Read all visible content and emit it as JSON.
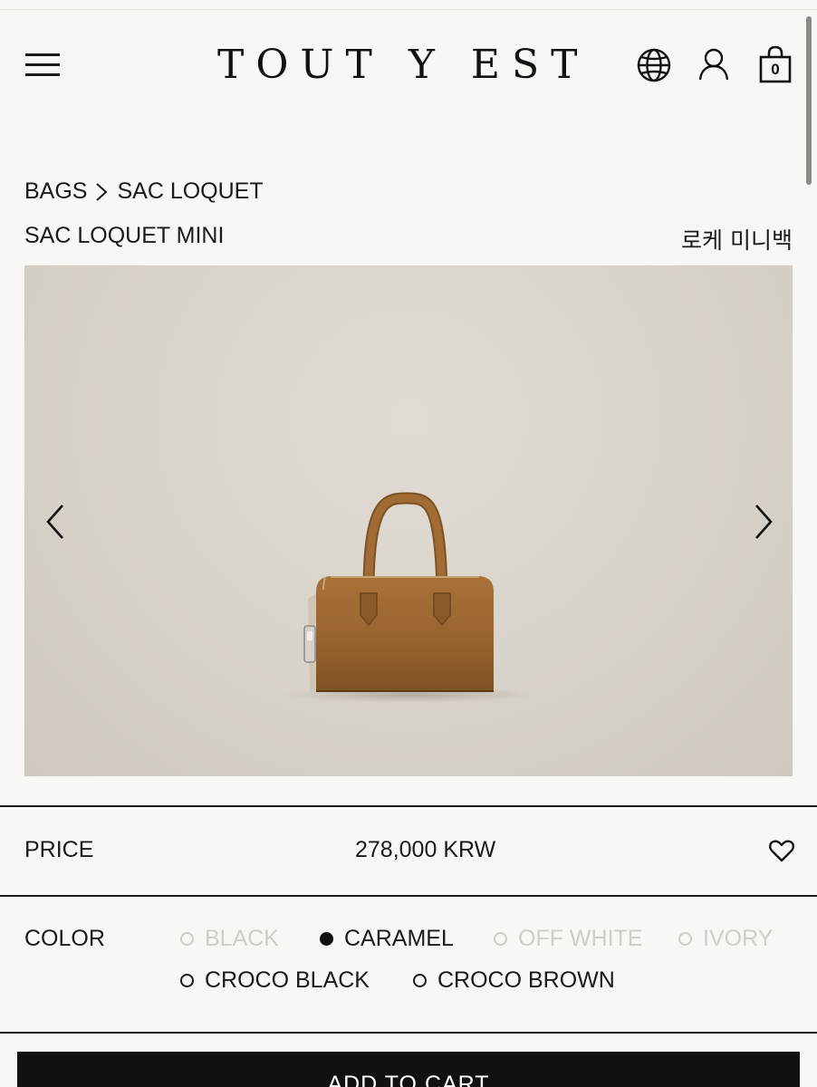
{
  "header": {
    "logo": "TOUT Y EST",
    "cart_count": "0"
  },
  "breadcrumb": {
    "category": "BAGS",
    "collection": "SAC LOQUET"
  },
  "product": {
    "title": "SAC LOQUET MINI",
    "title_ko": "로케 미니백"
  },
  "price": {
    "label": "PRICE",
    "value": "278,000 KRW"
  },
  "color": {
    "label": "COLOR",
    "options": [
      {
        "label": "BLACK",
        "state": "disabled"
      },
      {
        "label": "CARAMEL",
        "state": "selected"
      },
      {
        "label": "OFF WHITE",
        "state": "disabled"
      },
      {
        "label": "IVORY",
        "state": "disabled"
      },
      {
        "label": "CROCO BLACK",
        "state": "available"
      },
      {
        "label": "CROCO BROWN",
        "state": "available"
      }
    ]
  },
  "cart_button": {
    "label": "ADD TO CART"
  },
  "icons": {
    "menu": "hamburger-menu-icon",
    "language": "globe-icon",
    "account": "user-icon",
    "cart": "shopping-bag-icon",
    "prev": "chevron-left-icon",
    "next": "chevron-right-icon",
    "wishlist": "heart-icon",
    "breadcrumb_separator": "chevron-right-icon"
  },
  "colors": {
    "background": "#f8f7f4",
    "text": "#1a1a1a",
    "disabled_text": "#cfcdc8",
    "button_bg": "#111111",
    "product_caramel": "#9c6a33"
  }
}
